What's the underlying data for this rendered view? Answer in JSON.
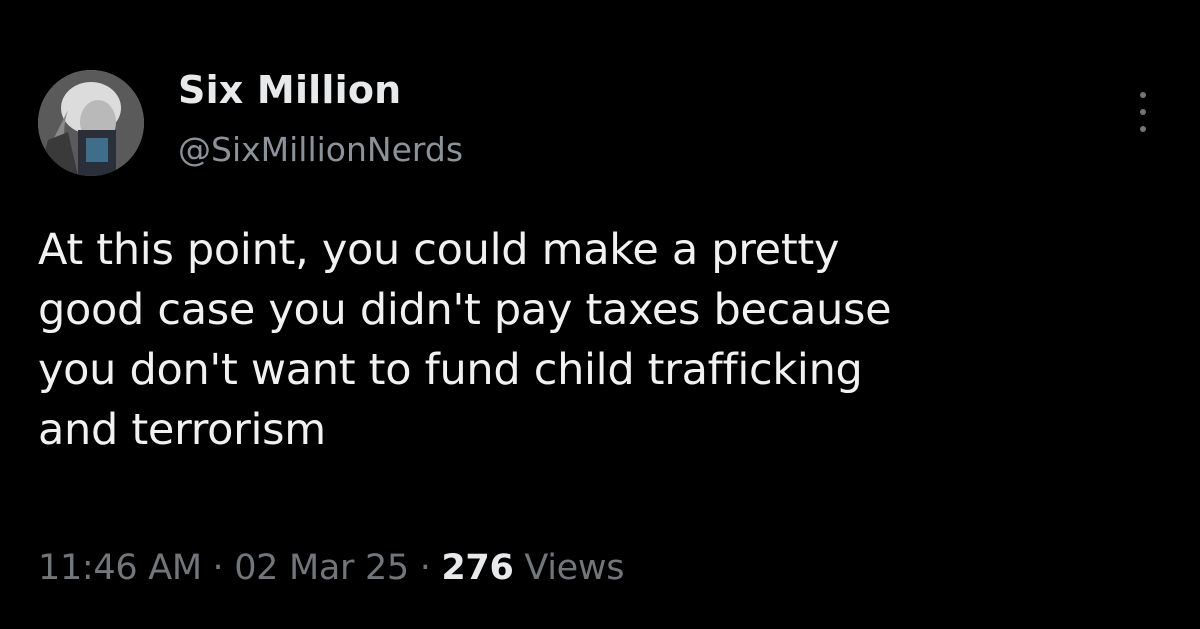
{
  "tweet": {
    "author": {
      "display_name": "Six Million",
      "handle": "@SixMillionNerds",
      "avatar_icon": "profile-photo"
    },
    "more_icon": "more-dots-vertical-icon",
    "text_lines": [
      "At this point, you could make a pretty",
      "good case you didn't pay taxes because",
      "you don't want to fund child trafficking",
      "and terrorism"
    ],
    "meta": {
      "time": "11:46 AM",
      "separator": " · ",
      "date": "02 Mar 25",
      "views_count": "276",
      "views_label": " Views"
    }
  },
  "colors": {
    "background": "#000000",
    "primary_text": "#e7e9ea",
    "secondary_text": "#71767b"
  }
}
